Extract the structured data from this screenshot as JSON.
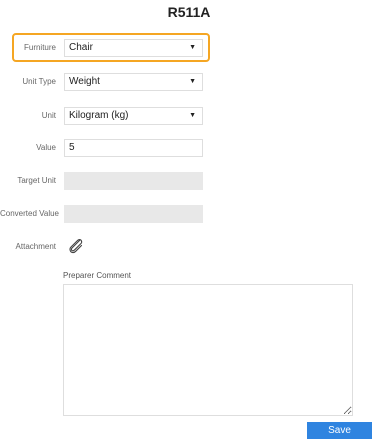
{
  "page": {
    "title": "R511A"
  },
  "form": {
    "furniture": {
      "label": "Furniture",
      "value": "Chair"
    },
    "unit_type": {
      "label": "Unit Type",
      "value": "Weight"
    },
    "unit": {
      "label": "Unit",
      "value": "Kilogram (kg)"
    },
    "value": {
      "label": "Value",
      "value": "5"
    },
    "target_unit": {
      "label": "Target Unit",
      "value": ""
    },
    "converted_value": {
      "label": "Converted Value",
      "value": ""
    },
    "attachment": {
      "label": "Attachment",
      "icon": "paperclip-icon"
    },
    "preparer_comment": {
      "label": "Preparer Comment",
      "value": ""
    }
  },
  "actions": {
    "save_label": "Save"
  },
  "colors": {
    "highlight": "#f5a623",
    "save_button": "#2f84e0",
    "disabled_field": "#e8e8e8"
  }
}
